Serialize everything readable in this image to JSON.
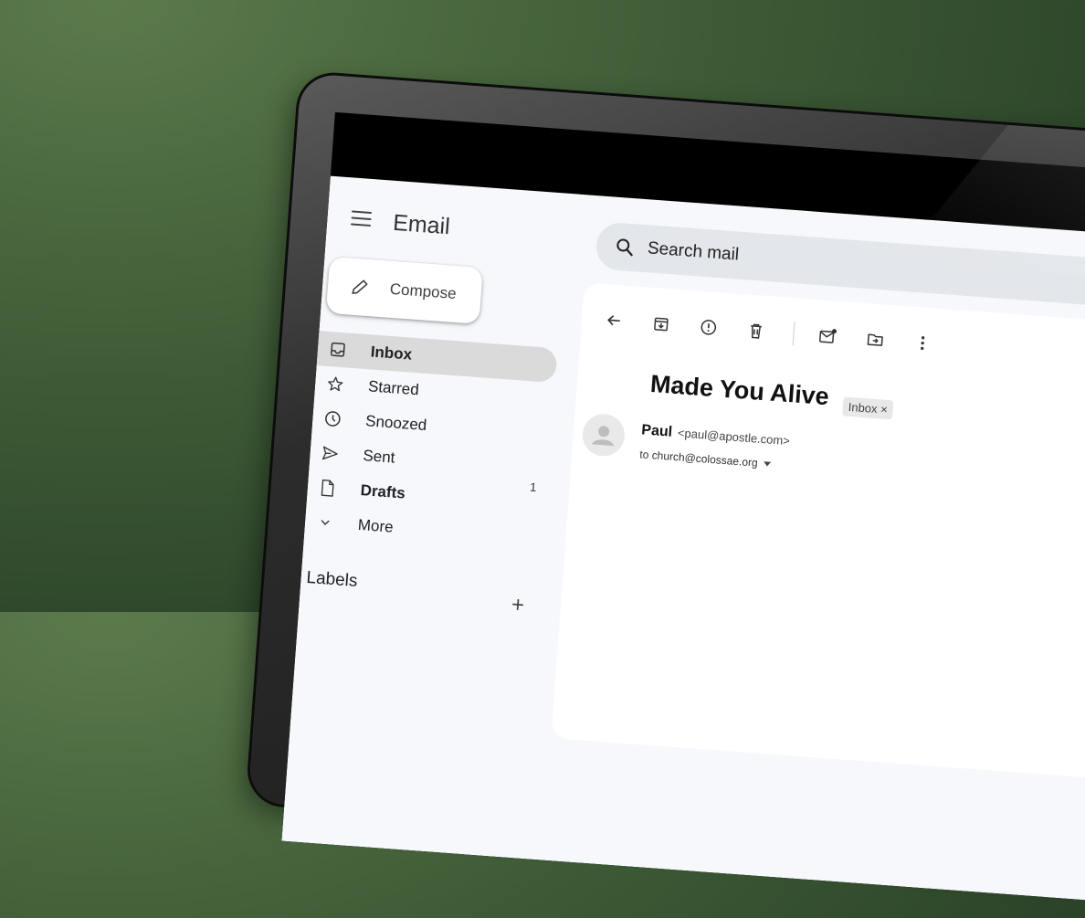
{
  "app": {
    "title": "Email"
  },
  "compose": {
    "label": "Compose"
  },
  "nav": {
    "items": [
      {
        "label": "Inbox",
        "icon": "inbox-icon",
        "count": ""
      },
      {
        "label": "Starred",
        "icon": "star-icon",
        "count": ""
      },
      {
        "label": "Snoozed",
        "icon": "clock-icon",
        "count": ""
      },
      {
        "label": "Sent",
        "icon": "send-icon",
        "count": ""
      },
      {
        "label": "Drafts",
        "icon": "draft-icon",
        "count": "1"
      },
      {
        "label": "More",
        "icon": "chevron-down-icon",
        "count": ""
      }
    ]
  },
  "labels": {
    "heading": "Labels",
    "add": "+"
  },
  "search": {
    "placeholder": "Search mail"
  },
  "toolbar": {
    "icons": [
      "back-arrow-icon",
      "archive-icon",
      "report-spam-icon",
      "delete-icon",
      "mark-unread-icon",
      "move-to-icon",
      "more-vert-icon"
    ]
  },
  "message": {
    "subject": "Made You Alive",
    "badge": "Inbox ×",
    "sender_name": "Paul",
    "sender_email": "<paul@apostle.com>",
    "recipient": "to church@colossae.org"
  },
  "colors": {
    "background": "#3d5a35",
    "active_nav": "#dadada",
    "search_bg": "#e3e6ea"
  }
}
